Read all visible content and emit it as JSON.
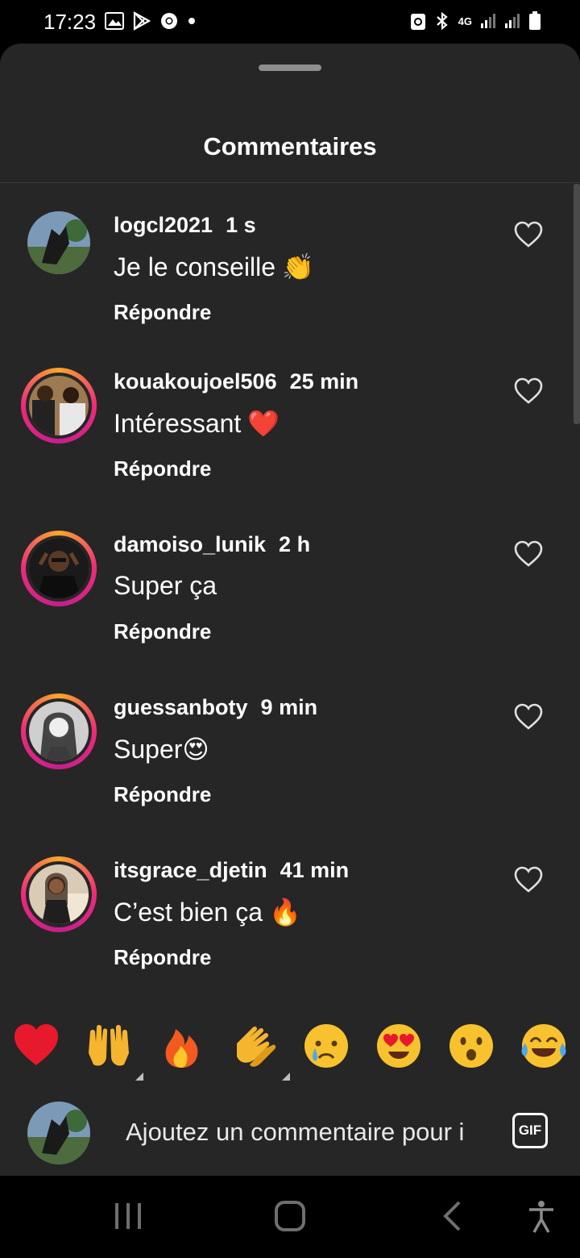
{
  "status_bar": {
    "time": "17:23",
    "network_label": "4G"
  },
  "sheet": {
    "title": "Commentaires"
  },
  "comments": [
    {
      "username": "logcl2021",
      "time": "1 s",
      "text": "Je le conseille",
      "emoji": "👏",
      "reply_label": "Répondre",
      "avatar_ring": false
    },
    {
      "username": "kouakoujoel506",
      "time": "25 min",
      "text": "Intéressant",
      "emoji": "❤️",
      "reply_label": "Répondre",
      "avatar_ring": true
    },
    {
      "username": "damoiso_lunik",
      "time": "2 h",
      "text": "Super ça",
      "emoji": "",
      "reply_label": "Répondre",
      "avatar_ring": true
    },
    {
      "username": "guessanboty",
      "time": "9 min",
      "text": "Super",
      "emoji": "😍",
      "reply_label": "Répondre",
      "avatar_ring": true
    },
    {
      "username": "itsgrace_djetin",
      "time": "41 min",
      "text": "C’est bien ça",
      "emoji": "🔥",
      "reply_label": "Répondre",
      "avatar_ring": true
    }
  ],
  "reactions": [
    "❤️",
    "🙌",
    "🔥",
    "👏",
    "😢",
    "😍",
    "😮",
    "😂"
  ],
  "compose": {
    "placeholder": "Ajoutez un commentaire pour i",
    "gif_label": "GIF"
  },
  "colors": {
    "sheet_bg": "#262626",
    "ring_start": "#f9a72a",
    "ring_end": "#c31f8d",
    "text": "#ffffff"
  },
  "icons": {
    "like": "heart-outline-icon",
    "nav": [
      "recents-icon",
      "home-icon",
      "back-icon",
      "accessibility-icon"
    ]
  }
}
